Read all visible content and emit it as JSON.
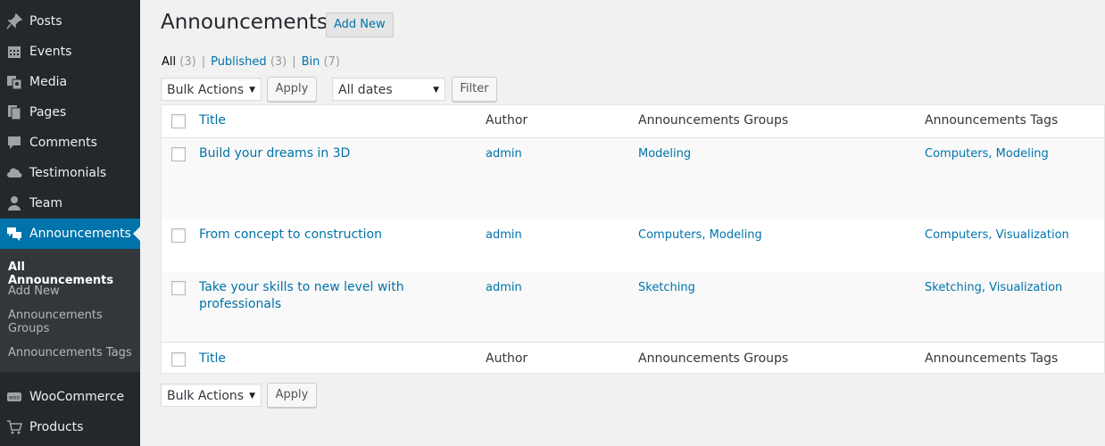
{
  "sidebar": {
    "items": [
      {
        "label": "Posts",
        "icon": "pin-icon"
      },
      {
        "label": "Events",
        "icon": "calendar-icon"
      },
      {
        "label": "Media",
        "icon": "media-icon"
      },
      {
        "label": "Pages",
        "icon": "pages-icon"
      },
      {
        "label": "Comments",
        "icon": "comment-icon"
      },
      {
        "label": "Testimonials",
        "icon": "cloud-icon"
      },
      {
        "label": "Team",
        "icon": "user-icon"
      },
      {
        "label": "Announcements",
        "icon": "announcement-icon"
      },
      {
        "label": "WooCommerce",
        "icon": "woocommerce-icon"
      },
      {
        "label": "Products",
        "icon": "cart-icon"
      }
    ],
    "submenu": [
      "All Announcements",
      "Add New",
      "Announcements Groups",
      "Announcements Tags"
    ]
  },
  "header": {
    "title": "Announcements",
    "add_new": "Add New"
  },
  "filters": {
    "all": "All",
    "all_count": "(3)",
    "published": "Published",
    "published_count": "(3)",
    "bin": "Bin",
    "bin_count": "(7)"
  },
  "actions": {
    "bulk_actions": "Bulk Actions",
    "apply": "Apply",
    "all_dates": "All dates",
    "filter": "Filter"
  },
  "table": {
    "columns": {
      "title": "Title",
      "author": "Author",
      "groups": "Announcements Groups",
      "tags": "Announcements Tags"
    },
    "rows": [
      {
        "title": "Build your dreams in 3D",
        "author": "admin",
        "groups": "Modeling",
        "tags": "Computers, Modeling"
      },
      {
        "title": "From concept to construction",
        "author": "admin",
        "groups": "Computers, Modeling",
        "tags": "Computers, Visualization"
      },
      {
        "title": "Take your skills to new level with professionals",
        "author": "admin",
        "groups": "Sketching",
        "tags": "Sketching, Visualization"
      }
    ]
  },
  "colors": {
    "sidebar_bg": "#23282d",
    "accent": "#0073aa",
    "page_bg": "#f1f1f1"
  }
}
